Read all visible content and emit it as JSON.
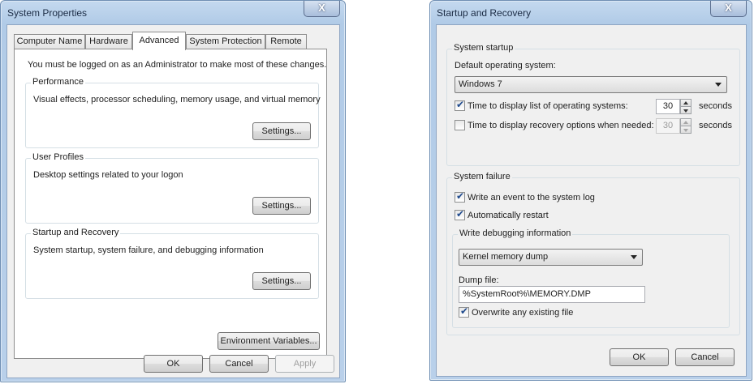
{
  "system_properties": {
    "title": "System Properties",
    "close_label": "X",
    "tabs": [
      {
        "label": "Computer Name"
      },
      {
        "label": "Hardware"
      },
      {
        "label": "Advanced"
      },
      {
        "label": "System Protection"
      },
      {
        "label": "Remote"
      }
    ],
    "active_tab": "Advanced",
    "admin_notice": "You must be logged on as an Administrator to make most of these changes.",
    "performance": {
      "title": "Performance",
      "description": "Visual effects, processor scheduling, memory usage, and virtual memory",
      "settings_label": "Settings..."
    },
    "user_profiles": {
      "title": "User Profiles",
      "description": "Desktop settings related to your logon",
      "settings_label": "Settings..."
    },
    "startup_recovery": {
      "title": "Startup and Recovery",
      "description": "System startup, system failure, and debugging information",
      "settings_label": "Settings..."
    },
    "env_vars_label": "Environment Variables...",
    "ok_label": "OK",
    "cancel_label": "Cancel",
    "apply_label": "Apply"
  },
  "startup_and_recovery": {
    "title": "Startup and Recovery",
    "close_label": "X",
    "system_startup": {
      "title": "System startup",
      "default_os_label": "Default operating system:",
      "default_os_value": "Windows 7",
      "display_list": {
        "label": "Time to display list of operating systems:",
        "checked": true,
        "value": "30",
        "unit": "seconds"
      },
      "display_recovery": {
        "label": "Time to display recovery options when needed:",
        "checked": false,
        "value": "30",
        "unit": "seconds"
      }
    },
    "system_failure": {
      "title": "System failure",
      "write_event": {
        "label": "Write an event to the system log",
        "checked": true
      },
      "auto_restart": {
        "label": "Automatically restart",
        "checked": true
      },
      "debugging": {
        "title": "Write debugging information",
        "dump_type": "Kernel memory dump",
        "dump_file_label": "Dump file:",
        "dump_file_value": "%SystemRoot%\\MEMORY.DMP",
        "overwrite": {
          "label": "Overwrite any existing file",
          "checked": true
        }
      }
    },
    "ok_label": "OK",
    "cancel_label": "Cancel"
  },
  "check_glyph": "✔"
}
